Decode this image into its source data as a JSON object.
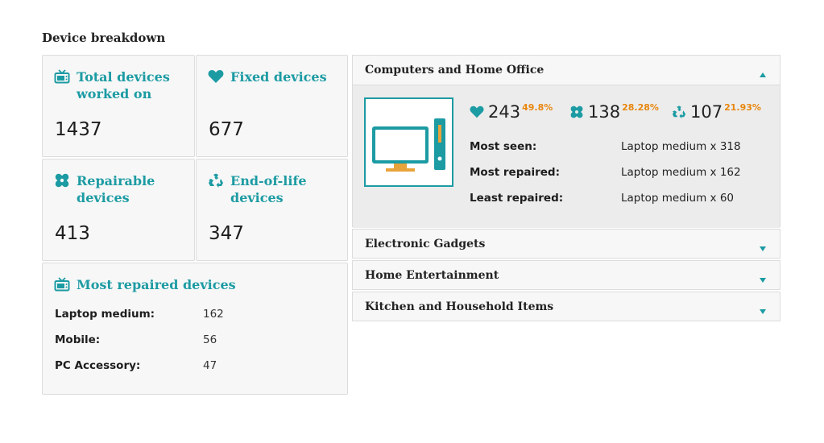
{
  "page": {
    "title": "Device breakdown"
  },
  "colors": {
    "accent": "#1c9ba3",
    "percent": "#e8870e",
    "card_bg": "#f7f7f7"
  },
  "cards": {
    "total": {
      "icon": "tv-icon",
      "title_line1": "Total devices",
      "title_line2": "worked on",
      "value": "1437"
    },
    "fixed": {
      "icon": "heart-icon",
      "title_line1": "Fixed devices",
      "value": "677"
    },
    "repairable": {
      "icon": "bandage-icon",
      "title_line1": "Repairable",
      "title_line2": "devices",
      "value": "413"
    },
    "eol": {
      "icon": "recycle-icon",
      "title_line1": "End-of-life",
      "title_line2": "devices",
      "value": "347"
    }
  },
  "most_repaired": {
    "icon": "tv-icon",
    "title": "Most repaired devices",
    "rows": [
      {
        "label": "Laptop medium:",
        "value": "162"
      },
      {
        "label": "Mobile:",
        "value": "56"
      },
      {
        "label": "PC Accessory:",
        "value": "47"
      }
    ]
  },
  "categories": [
    {
      "title": "Computers and Home Office",
      "expanded": true,
      "image_icon": "computer-icon",
      "stats": {
        "fixed": {
          "icon": "heart-icon",
          "value": "243",
          "percent": "49.8%"
        },
        "repairable": {
          "icon": "bandage-icon",
          "value": "138",
          "percent": "28.28%"
        },
        "eol": {
          "icon": "recycle-icon",
          "value": "107",
          "percent": "21.93%"
        }
      },
      "info": [
        {
          "label": "Most seen:",
          "value": "Laptop medium x 318"
        },
        {
          "label": "Most repaired:",
          "value": "Laptop medium x 162"
        },
        {
          "label": "Least repaired:",
          "value": "Laptop medium x 60"
        }
      ]
    },
    {
      "title": "Electronic Gadgets",
      "expanded": false
    },
    {
      "title": "Home Entertainment",
      "expanded": false
    },
    {
      "title": "Kitchen and Household Items",
      "expanded": false
    }
  ]
}
